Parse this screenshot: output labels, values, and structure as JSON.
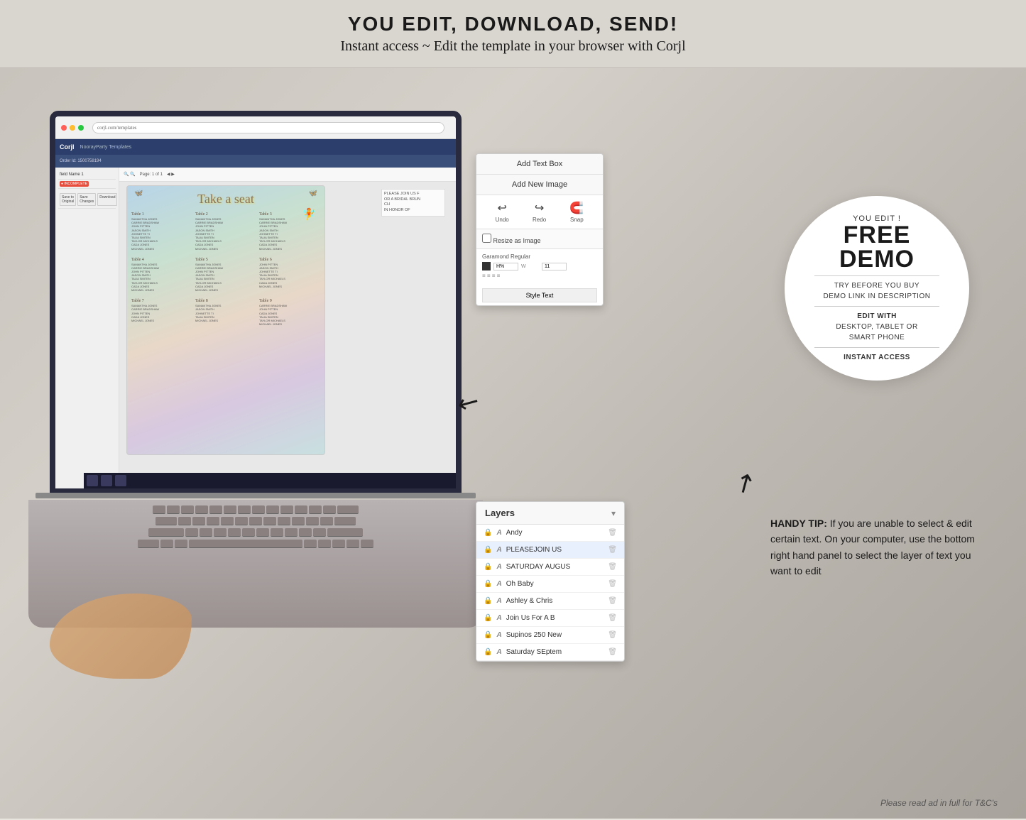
{
  "header": {
    "title": "YOU EDIT, DOWNLOAD, SEND!",
    "subtitle": "Instant access ~ Edit the template in your browser with Corjl"
  },
  "demo_circle": {
    "you_edit": "YOU EDIT !",
    "free": "FREE",
    "demo": "DEMO",
    "line1": "TRY BEFORE YOU BUY",
    "line2": "DEMO LINK IN DESCRIPTION",
    "edit_with": "EDIT WITH",
    "platforms": "DESKTOP, TABLET OR",
    "smartphone": "SMART PHONE",
    "instant": "INSTANT ACCESS"
  },
  "editor_panel": {
    "add_text_box": "Add Text Box",
    "add_new_image": "Add New Image",
    "undo_label": "Undo",
    "redo_label": "Redo",
    "snap_label": "Snap",
    "style_text": "Style Text",
    "resize_as_image": "Resize as Image",
    "font_label": "Garamond Regular"
  },
  "layers_panel": {
    "title": "Layers",
    "chevron": "▾",
    "items": [
      {
        "lock": "🔒",
        "type": "A",
        "name": "Andy",
        "active": false
      },
      {
        "lock": "🔒",
        "type": "A",
        "name": "PLEASEJOIN US",
        "active": true
      },
      {
        "lock": "🔒",
        "type": "A",
        "name": "SATURDAY AUGUS",
        "active": false
      },
      {
        "lock": "🔒",
        "type": "A",
        "name": "Oh Baby",
        "active": false
      },
      {
        "lock": "🔒",
        "type": "A",
        "name": "Ashley & Chris",
        "active": false
      },
      {
        "lock": "🔒",
        "type": "A",
        "name": "Join Us For A B",
        "active": false
      },
      {
        "lock": "🔒",
        "type": "A",
        "name": "Supinos 250 New",
        "active": false
      },
      {
        "lock": "🔒",
        "type": "A",
        "name": "Saturday SEptem",
        "active": false
      }
    ]
  },
  "handy_tip": {
    "label": "HANDY TIP:",
    "text": " If you are unable to select & edit certain text. On your computer, use the bottom right hand panel to select the layer of text you want to edit"
  },
  "seating_chart": {
    "title": "Take a seat",
    "tables": [
      {
        "header": "Table 1",
        "names": [
          "SAMANTHA JONES",
          "CARRIE BRADSHAW",
          "JOHN PITTEN",
          "JASON SMITH",
          "JOHNETTE TI",
          "TALIA SMITEN",
          "TAYLOR MICHAELS",
          "CADA JONES",
          "MICHAEL JONES"
        ]
      },
      {
        "header": "Table 2",
        "names": [
          "SAMANTHA JONES",
          "CARRIE BRADSHAW",
          "JOHN PITTEN",
          "JASON SMITH",
          "JOHNETTE TI",
          "TALIA SMITEN",
          "TAYLOR MICHAELS",
          "CADA JONES",
          "MICHAEL JONES"
        ]
      },
      {
        "header": "Table 3",
        "names": [
          "SAMANTHA JONES",
          "CARRIE BRADSHAW",
          "JOHN PITTEN",
          "JASON SMITH",
          "JOHNETTE TI",
          "TALIA SMITEN",
          "TAYLOR MICHAELS",
          "CADA JONES",
          "MICHAEL JONES"
        ]
      }
    ]
  },
  "footer": {
    "note": "Please read ad in full for T&C's"
  },
  "browser": {
    "url": "corjl.com/templates",
    "tabs": [
      "Corjl | NoorayParty Templates"
    ]
  },
  "corjl": {
    "logo": "Corjl",
    "brand": "NoorayParty Templates",
    "order_id": "Order Id: 1500758194"
  }
}
